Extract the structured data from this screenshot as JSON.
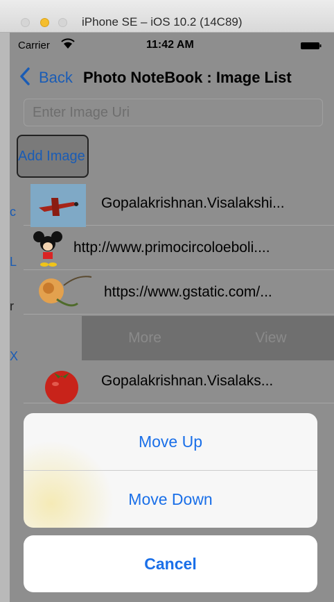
{
  "window": {
    "title": "iPhone SE – iOS 10.2 (14C89)"
  },
  "status_bar": {
    "carrier": "Carrier",
    "time": "11:42 AM"
  },
  "nav": {
    "back_label": "Back",
    "title": "Photo NoteBook : Image List"
  },
  "form": {
    "uri_placeholder": "Enter Image Uri",
    "add_button": "Add Image"
  },
  "rows": [
    {
      "label": "Gopalakrishnan.Visalakshi...",
      "thumb": "airplane-thumbnail"
    },
    {
      "label": "http://www.primocircoloeboli....",
      "thumb": "mickey-thumbnail"
    },
    {
      "label": "https://www.gstatic.com/...",
      "thumb": "rose-thumbnail"
    },
    {
      "label": "Gopalakrishnan.Visalaks...",
      "thumb": "tomato-thumbnail"
    }
  ],
  "swipe_actions": {
    "more": "More",
    "view": "View"
  },
  "action_sheet": {
    "move_up": "Move Up",
    "move_down": "Move Down",
    "cancel": "Cancel"
  },
  "colors": {
    "accent": "#1a6fe8",
    "back_blue": "#1a5cb5",
    "dim_background": "#8e8e8e"
  }
}
